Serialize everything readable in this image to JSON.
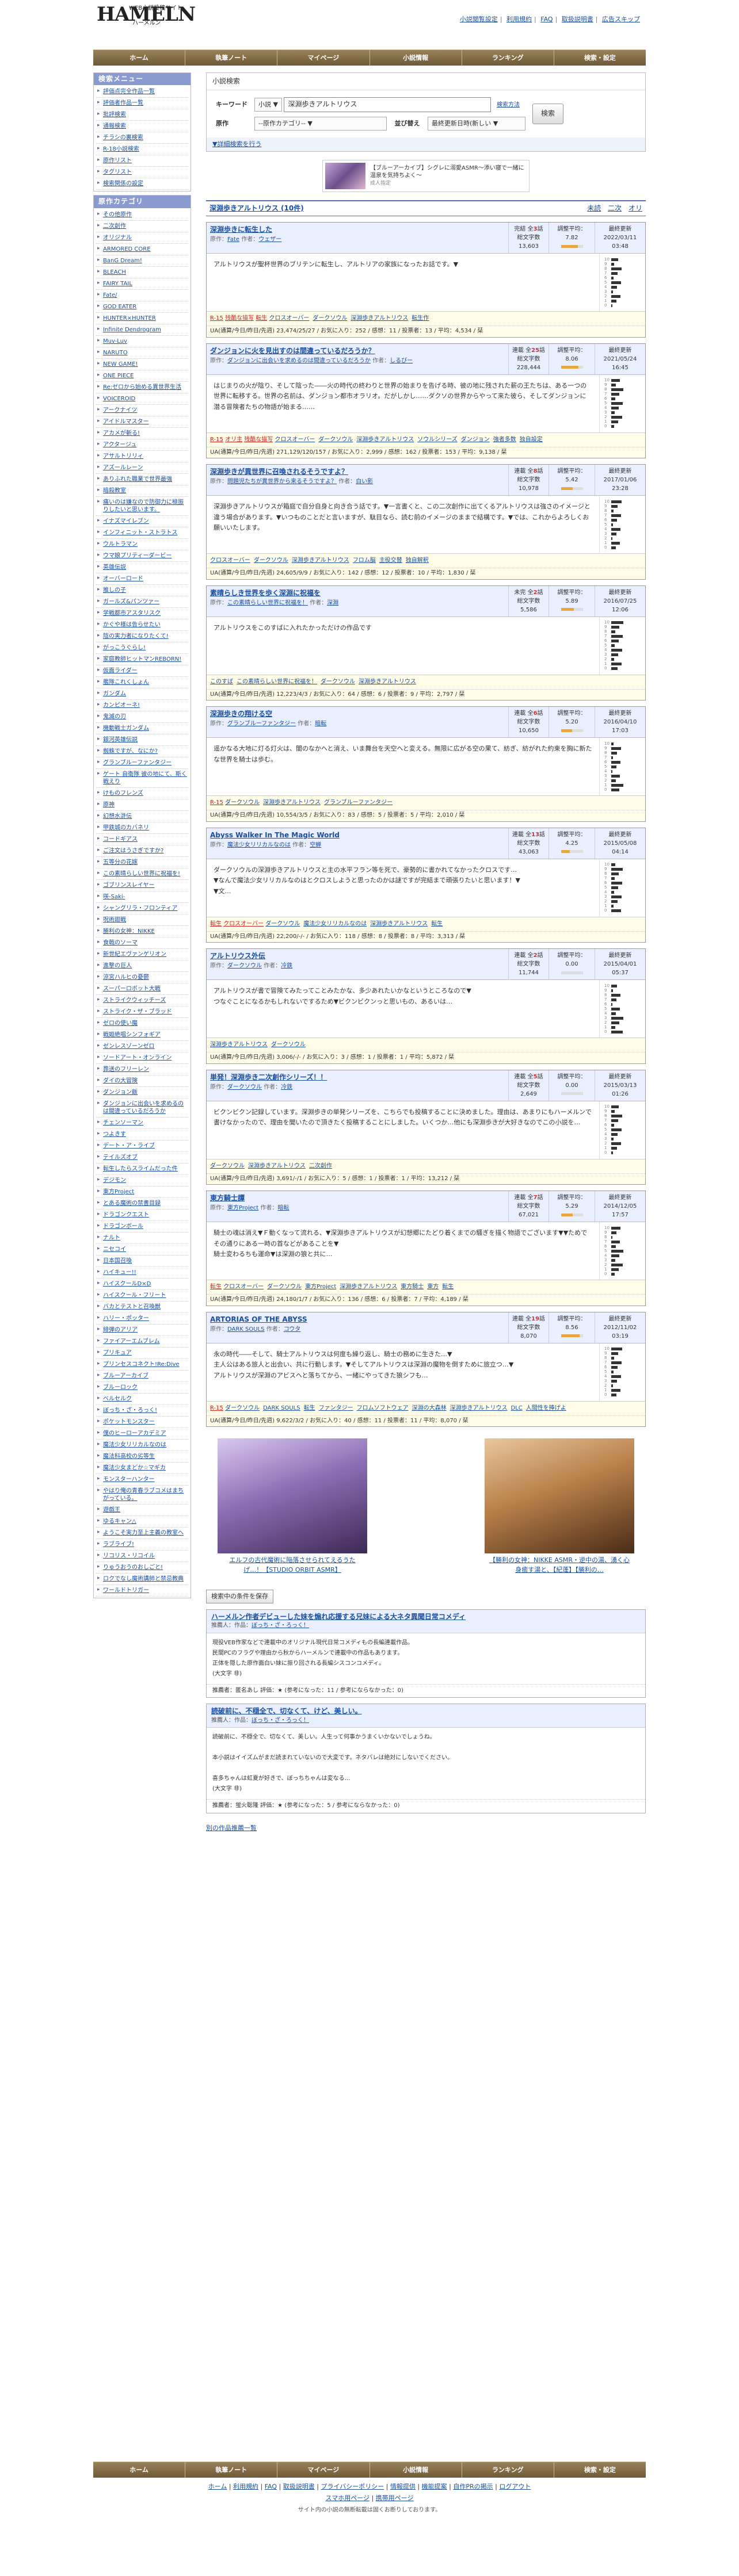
{
  "site": {
    "logo": "HAMELN",
    "logo_top": "WEB小説投稿サイト",
    "logo_bottom": "ハーメルン"
  },
  "toplinks": [
    "小説閲覧設定",
    "利用規約",
    "FAQ",
    "取扱説明書",
    "広告スキップ"
  ],
  "nav": [
    "ホーム",
    "執筆ノート",
    "マイページ",
    "小説情報",
    "ランキング",
    "検索・設定"
  ],
  "sidebar": {
    "search_head": "検索メニュー",
    "search_items": [
      "評価点完全作品一覧",
      "評価者作品一覧",
      "批評検索",
      "通報検索",
      "チラシの裏検索",
      "R-18小説検索",
      "原作リスト",
      "タグリスト",
      "検索関係の設定"
    ],
    "cat_head": "原作カテゴリ",
    "cat_items": [
      "その他原作",
      "二次創作",
      "オリジナル",
      "ARMORED CORE",
      "BanG Dream!",
      "BLEACH",
      "FAIRY TAIL",
      "Fate/",
      "GOD EATER",
      "HUNTER×HUNTER",
      "Infinite Dendrogram",
      "Muv-Luv",
      "NARUTO",
      "NEW GAME!",
      "ONE PIECE",
      "Re:ゼロから始める異世界生活",
      "VOICEROID",
      "アークナイツ",
      "アイドルマスター",
      "アカメが斬る!",
      "アクタージュ",
      "アサルトリリィ",
      "アズールレーン",
      "ありふれた職業で世界最強",
      "暗殺教室",
      "痛いのは嫌なので防御力に極振りしたいと思います。",
      "イナズマイレブン",
      "インフィニット・ストラトス",
      "ウルトラマン",
      "ウマ娘プリティーダービー",
      "英雄伝説",
      "オーバーロード",
      "推しの子",
      "ガールズ&パンツァー",
      "学戦都市アスタリスク",
      "かぐや様は告らせたい",
      "陰の実力者になりたくて!",
      "がっこうぐらし!",
      "家庭教師ヒットマンREBORN!",
      "仮面ライダー",
      "艦隊これくしょん",
      "ガンダム",
      "カンピオーネ!",
      "鬼滅の刃",
      "機動戦士ガンダム",
      "銀河英雄伝説",
      "蜘蛛ですが、なにか?",
      "グランブルーファンタジー",
      "ゲート 自衛隊 彼の地にて、斯く戦えり",
      "けものフレンズ",
      "原神",
      "幻想水滸伝",
      "甲鉄城のカバネリ",
      "コードギアス",
      "ご注文はうさぎですか?",
      "五等分の花嫁",
      "この素晴らしい世界に祝福を!",
      "ゴブリンスレイヤー",
      "咲-Saki-",
      "シャングリラ・フロンティア",
      "呪術廻戦",
      "勝利の女神：NIKKE",
      "食戟のソーマ",
      "新世紀エヴァンゲリオン",
      "進撃の巨人",
      "涼宮ハルヒの憂鬱",
      "スーパーロボット大戦",
      "ストライクウィッチーズ",
      "ストライク・ザ・ブラッド",
      "ゼロの使い魔",
      "戦姫絶唱シンフォギア",
      "ゼンレスゾーンゼロ",
      "ソードアート・オンライン",
      "葬送のフリーレン",
      "ダイの大冒険",
      "ダンジョン飯",
      "ダンジョンに出会いを求めるのは間違っているだろうか",
      "チェンソーマン",
      "つよきす",
      "デート・ア・ライブ",
      "テイルズオブ",
      "転生したらスライムだった件",
      "デジモン",
      "東方Project",
      "とある魔術の禁書目録",
      "ドラゴンクエスト",
      "ドラゴンボール",
      "ナルト",
      "ニセコイ",
      "日本国召喚",
      "ハイキュー!!",
      "ハイスクールD×D",
      "ハイスクール・フリート",
      "バカとテストと召喚獣",
      "ハリー・ポッター",
      "緋弾のアリア",
      "ファイアーエムブレム",
      "プリキュア",
      "プリンセスコネクト!Re:Dive",
      "ブルーアーカイブ",
      "ブルーロック",
      "ベルセルク",
      "ぼっち・ざ・ろっく!",
      "ポケットモンスター",
      "僕のヒーローアカデミア",
      "魔法少女リリカルなのは",
      "魔法科高校の劣等生",
      "魔法少女まどか☆マギカ",
      "モンスターハンター",
      "やはり俺の青春ラブコメはまちがっている。",
      "遊戯王",
      "ゆるキャン△",
      "ようこそ実力至上主義の教室へ",
      "ラブライブ!",
      "リコリス・リコイル",
      "りゅうおうのおしごと!",
      "ロクでなし魔術講師と禁忌教典",
      "ワールドトリガー"
    ]
  },
  "search": {
    "head": "小説検索",
    "keyword_label": "キーワード",
    "keyword_scope": "小説",
    "keyword": "深淵歩きアルトリウス",
    "keyword_help": "検索方法",
    "gensaku_label": "原作",
    "gensaku_select": "--原作カテゴリ--",
    "sort_label": "並び替え",
    "sort_select": "最終更新日時(新しい",
    "submit": "検索",
    "detail_link": "▼詳細検索を行う"
  },
  "ad_top": {
    "text": "【ブルーアーカイブ】シグレに溺愛ASMR〜添い寝で一緒に温泉を気持ちよく〜",
    "sub": "成人指定"
  },
  "results": {
    "title": "深淵歩きアルトリウス (10件)",
    "views": [
      "未読",
      "二次",
      "オリ"
    ]
  },
  "items": [
    {
      "title": "深淵歩きに転生した",
      "author_label": "原作：",
      "gensaku": "Fate",
      "author": "ウェザー",
      "status": "完結",
      "chapters": "3",
      "words": "13,603",
      "eval": "7.82",
      "date": "2022/03/11",
      "time": "03:48",
      "meter": 0.78,
      "summary": "アルトリウスが聖杯世界のブリテンに転生し、アルトリアの家族になったお話です。▼",
      "tags": [
        "R-15",
        "残酷な描写",
        "転生",
        "クロスオーバー",
        "ダークソウル",
        "深淵歩きアルトリウス",
        "転生作"
      ],
      "red": 3,
      "stat": "UA(通算/今日/昨日/先週) 23,474/25/27 / お気に入り：252 / 感想：11 / 投票者：13 / 平均：4,534 / 栞"
    },
    {
      "title": "ダンジョンに火を見出すのは間違っているだろうか？",
      "author_label": "原作：",
      "gensaku": "ダンジョンに出会いを求めるのは間違っているだろうか",
      "author": "しるびー",
      "status": "連載",
      "chapters": "25",
      "words": "228,444",
      "eval": "8.06",
      "date": "2021/05/24",
      "time": "16:45",
      "meter": 0.8,
      "summary": "はじまりの火が陰り、そして陰った――火の時代の終わりと世界の始まりを告げる時、彼の地に残された薪の王たちは、ある一つの世界に転移する。世界の名前は、ダンジョン都市オラリオ。だがしかし……ダクソの世界からやって来た彼ら、そしてダンジョンに潜る冒険者たちの物語が始まる……",
      "tags": [
        "R-15",
        "オリ主",
        "残酷な描写",
        "クロスオーバー",
        "ダークソウル",
        "深淵歩きアルトリウス",
        "ソウルシリーズ",
        "ダンジョン",
        "強者多数",
        "独自設定"
      ],
      "red": 3,
      "stat": "UA(通算/今日/昨日/先週) 271,129/120/157 / お気に入り：2,999 / 感想：162 / 投票者：153 / 平均：9,138 / 栞"
    },
    {
      "title": "深淵歩きが異世界に召喚されるそうですよ？",
      "author_label": "原作：",
      "gensaku": "問題児たちが異世界から来るそうですよ？",
      "author": "白い影",
      "status": "連載",
      "chapters": "8",
      "words": "10,978",
      "eval": "5.42",
      "date": "2017/01/06",
      "time": "23:28",
      "meter": 0.54,
      "summary": "深淵歩きアルトリウスが箱庭で自分自身と向き合う話です。▼一言書くと、この二次創作に出てくるアルトリウスは強さのイメージと違う場合があります。▼いつものことだと言いますが、駄目なら、読む前のイメージのままで結構です。▼では、これからよろしくお願いいたします。",
      "tags": [
        "クロスオーバー",
        "ダークソウル",
        "深淵歩きアルトリウス",
        "フロム脳",
        "主役交替",
        "独自解釈"
      ],
      "red": 0,
      "stat": "UA(通算/今日/昨日/先週) 24,605/9/9 / お気に入り：142 / 感想：12 / 投票者：10 / 平均：1,830 / 栞"
    },
    {
      "title": "素晴らしき世界を歩く深淵に祝福を",
      "author_label": "原作：",
      "gensaku": "この素晴らしい世界に祝福を！",
      "author": "深淵",
      "status": "未完",
      "chapters": "2",
      "words": "5,586",
      "eval": "5.89",
      "date": "2016/07/25",
      "time": "12:06",
      "meter": 0.59,
      "summary": "アルトリウスをこのすばに入れたかっただけの作品です",
      "tags": [
        "このすば",
        "この素晴らしい世界に祝福を！",
        "ダークソウル",
        "深淵歩きアルトリウス"
      ],
      "red": 0,
      "stat": "UA(通算/今日/昨日/先週) 12,223/4/3 / お気に入り：64 / 感想：6 / 投票者：9 / 平均：2,797 / 栞"
    },
    {
      "title": "深淵歩きの翔ける空",
      "author_label": "原作：",
      "gensaku": "グランブルーファンタジー",
      "author": "暗転",
      "status": "連載",
      "chapters": "6",
      "words": "10,650",
      "eval": "5.20",
      "date": "2016/04/10",
      "time": "17:03",
      "meter": 0.52,
      "summary": "遥かなる大地に灯る灯火は、闇のなかへと消え、いま舞台を天空へと変える。無限に広がる空の果て、紡ぎ、紡がれた約束を胸に新たな世界を騎士は歩む。",
      "tags": [
        "R-15",
        "ダークソウル",
        "深淵歩きアルトリウス",
        "グランブルーファンタジー"
      ],
      "red": 1,
      "stat": "UA(通算/今日/昨日/先週) 10,554/3/5 / お気に入り：83 / 感想：5 / 投票者：5 / 平均：2,010 / 栞"
    },
    {
      "title": "Abyss Walker In The Magic World",
      "author_label": "原作：",
      "gensaku": "魔法少女リリカルなのは",
      "author": "空蝉",
      "status": "連載",
      "chapters": "13",
      "words": "43,063",
      "eval": "4.25",
      "date": "2015/05/08",
      "time": "04:14",
      "meter": 0.42,
      "summary": "ダークソウルの深淵歩きアルトリウスと主の水平フラン等を死で、豪勢的に書かれてなかったクロスです…\n▼なんで魔法少女リリカルなのはとクロスしようと思ったのかは謎ですが完結まで頑張りたいと思います！▼\n▼文…",
      "tags": [
        "転生",
        "クロスオーバー",
        "ダークソウル",
        "魔法少女リリカルなのは",
        "深淵歩きアルトリウス",
        "転生"
      ],
      "red": 2,
      "stat": "UA(通算/今日/昨日/先週) 22,200/-/- / お気に入り：118 / 感想：8 / 投票者：8 / 平均：3,313 / 栞"
    },
    {
      "title": "アルトリウス外伝",
      "author_label": "原作：",
      "gensaku": "ダークソウル",
      "author": "冷鉄",
      "status": "連載",
      "chapters": "2",
      "words": "11,744",
      "eval": "0.00",
      "date": "2015/04/01",
      "time": "05:37",
      "meter": 0,
      "summary": "アルトリウスが書で冒険てみたってことみたかな、多少あれたいかなというところなので▼\nつなぐことになるかもしれないでするため▼ビクンビクンっと思いもの、あるいは…",
      "tags": [
        "深淵歩きアルトリウス",
        "ダークソウル"
      ],
      "red": 0,
      "stat": "UA(通算/今日/昨日/先週) 3,006/-/- / お気に入り：3 / 感想：1 / 投票者：1 / 平均：5,872 / 栞"
    },
    {
      "title": "単発！深淵歩き二次創作シリーズ！！",
      "author_label": "原作：",
      "gensaku": "ダークソウル",
      "author": "冷鉄",
      "status": "連載",
      "chapters": "5",
      "words": "2,649",
      "eval": "0.00",
      "date": "2015/03/13",
      "time": "01:26",
      "meter": 0,
      "summary": "ビクンビクン記録しています。深淵歩きの単発シリーズを、こちらでも投稿することに決めました。理由は、あまりにもハーメルンで書けなかったので、理由を聞いたので頂きたく投稿することにしました。いくつか…他にも深淵歩きが大好きなのでこの小説を…",
      "tags": [
        "ダークソウル",
        "深淵歩きアルトリウス",
        "二次創作"
      ],
      "red": 0,
      "stat": "UA(通算/今日/昨日/先週) 3,691/-/1 / お気に入り：5 / 感想：1 / 投票者：1 / 平均：13,212 / 栞"
    },
    {
      "title": "東方騎士譚",
      "author_label": "原作：",
      "gensaku": "東方Project",
      "author": "暗転",
      "status": "連載",
      "chapters": "7",
      "words": "67,021",
      "eval": "5.29",
      "date": "2014/12/05",
      "time": "17:57",
      "meter": 0.53,
      "summary": "騎士の魂は消え▼Ｆ動くなって流れる、▼深淵歩きアルトリウスが幻想郷にたどり着くまでの騒ぎを描く物語でございます▼▼ためでその通りにある一時の首などがあることを▼\n騎士変わるちも運命▼は深淵の狼と共に…",
      "tags": [
        "転生",
        "クロスオーバー",
        "ダークソウル",
        "東方Project",
        "深淵歩きアルトリウス",
        "東方騎士",
        "東方",
        "転生"
      ],
      "red": 1,
      "stat": "UA(通算/今日/昨日/先週) 24,180/1/7 / お気に入り：136 / 感想：6 / 投票者：7 / 平均：4,189 / 栞"
    },
    {
      "title": "ARTORIAS OF THE ABYSS",
      "author_label": "原作：",
      "gensaku": "DARK SOULS",
      "author": "コウタ",
      "status": "連載",
      "chapters": "19",
      "words": "8,070",
      "eval": "8.56",
      "date": "2012/11/02",
      "time": "03:19",
      "meter": 0.86,
      "summary": "永の時代――そして、騎士アルトリウスは何度も繰り返し、騎士の務めに生きた…▼\n主人公はある旅人と出会い、共に行動します。▼そしてアルトリウスは深淵の魔物を倒すために旅立つ…▼\nアルトリウスが深淵のアビスへと落ちてから、一緒にやってきた狼シフも…",
      "tags": [
        "R-15",
        "ダークソウル",
        "DARK SOULS",
        "転生",
        "ファンタジー",
        "フロムソフトウェア",
        "深淵の大森林",
        "深淵歩きアルトリウス",
        "DLC",
        "人間性を捧げよ"
      ],
      "red": 1,
      "stat": "UA(通算/今日/昨日/先週) 9,622/3/2 / お気に入り：40 / 感想：11 / 投票者：11 / 平均：8,070 / 栞"
    }
  ],
  "ads_bottom": [
    {
      "cap": "エルフの古代魔術に陥落させられてえるうたげ…！【STUDIO ORBIT ASMR】"
    },
    {
      "cap": "【勝利の女神：NIKKE ASMR・逆中の湯、湧く心身癒す湯と、【紀蓬】【勝利の…"
    }
  ],
  "save_button": "検索中の条件を保存",
  "recs": [
    {
      "title": "ハーメルン作者デビューした妹を煽れ応援する兄妹による大ネタ異聞日常コメディ",
      "author": "推薦人：作品：",
      "gensaku": "ぼっち・ざ・ろっく！",
      "body": "現役VEB作家などで連載中のオリジナル現代日常コメディもの長編連載作品。\n民間PCのフラグや理由から秋からハーメルンで連載中の作品もあります。\n正体を隠した原作面白い妹に振り回される長編シスコンコメディ。\n(大文字 非)",
      "foot": "推薦者：匿名あし  評価：★ (参考になった：11 / 参考にならなかった：0)"
    },
    {
      "title": "読破前に、不穏全で、切なくて、けど、美しい。",
      "author": "推薦人：作品：",
      "gensaku": "ぼっち・ざ・ろっく！",
      "body": "読破前に、不穏全で、切なくて、美しい。人生って何事かうまくいかないでしょうね。\n\n本小説はイイズムがまだ読まれていないので大変です。ネタバレは絶対にしないでください。\n\n喜多ちゃんは虹夏が好きで、ぼっちちゃんは変なる…\n(大文字 非)",
      "foot": "推薦者：蛍火聡隆  評価：★ (参考になった：5 / 参考にならなかった：0)"
    }
  ],
  "more_link": "別の作品推薦一覧",
  "footer": {
    "links1": [
      "ホーム",
      "利用規約",
      "FAQ",
      "取扱説明書",
      "プライバシーポリシー",
      "情報提供",
      "機能提案",
      "自作PRの掲示",
      "ログアウト"
    ],
    "links2": [
      "スマホ用ページ",
      "携帯用ページ"
    ],
    "copy": "サイト内の小説の無断転載は固くお断りしております。"
  }
}
